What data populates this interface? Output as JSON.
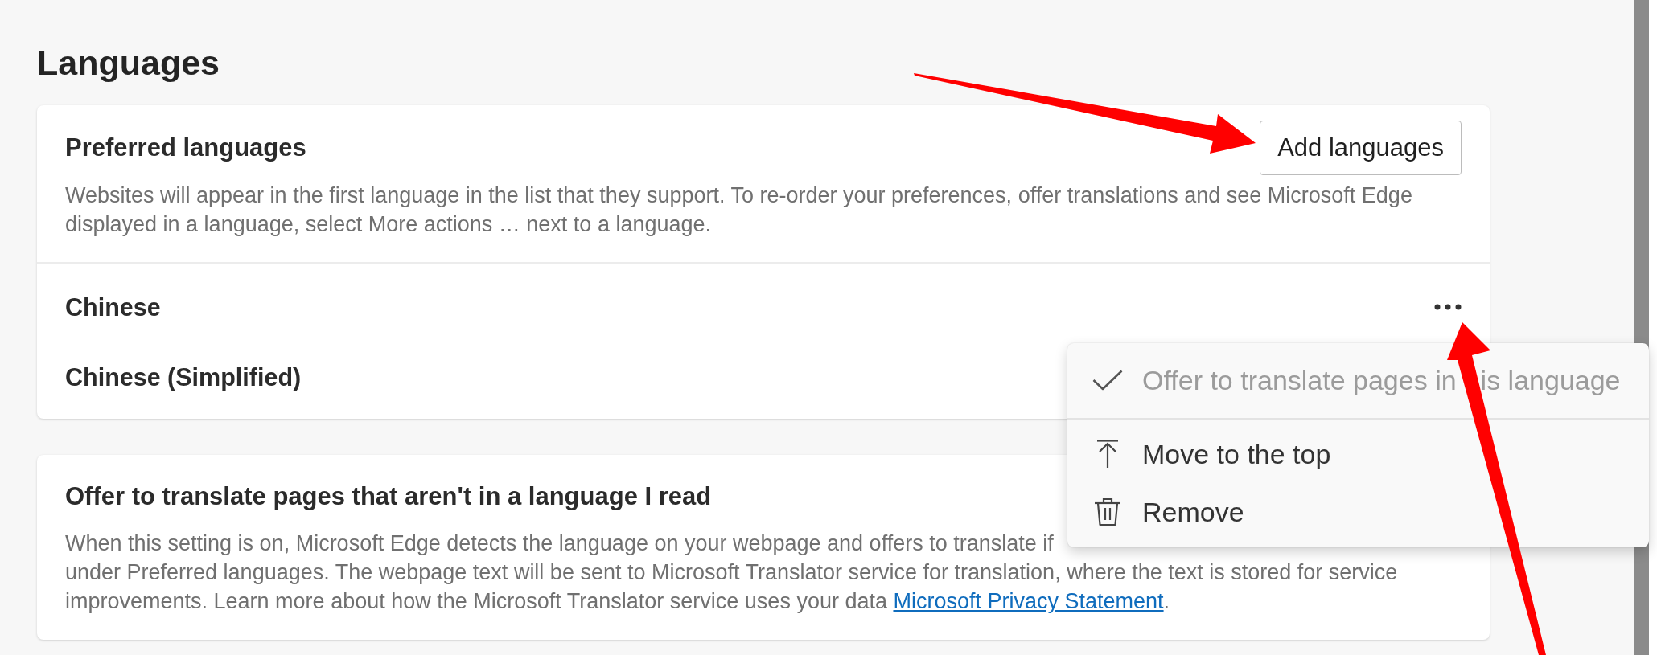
{
  "page": {
    "title": "Languages"
  },
  "preferred_languages": {
    "title": "Preferred languages",
    "button": "Add languages",
    "description": "Websites will appear in the first language in the list that they support. To re-order your preferences, offer translations and see Microsoft Edge displayed in a language, select More actions … next to a language.",
    "languages": [
      {
        "name": "Chinese",
        "menu_open": true
      },
      {
        "name": "Chinese (Simplified)",
        "menu_open": false
      }
    ]
  },
  "translate_setting": {
    "title": "Offer to translate pages that aren't in a language I read",
    "description": "When this setting is on, Microsoft Edge detects the language on your webpage and offers to translate if\nunder Preferred languages. The webpage text will be sent to Microsoft Translator service for translation, where the text is stored for service improvements. Learn more about how the Microsoft Translator service uses your data",
    "link": "Microsoft Privacy Statement",
    "link_suffix": "."
  },
  "context_menu": {
    "items": [
      {
        "kind": "toggle",
        "label": "Offer to translate pages in",
        "label_rest": "is language",
        "checked": true,
        "disabled": true
      },
      {
        "kind": "move",
        "label": "Move to the top",
        "checked": false,
        "disabled": false
      },
      {
        "kind": "remove",
        "label": "Remove",
        "checked": false,
        "disabled": false
      }
    ]
  },
  "annotations": [
    {
      "kind": "arrow"
    },
    {
      "kind": "arrow"
    }
  ]
}
